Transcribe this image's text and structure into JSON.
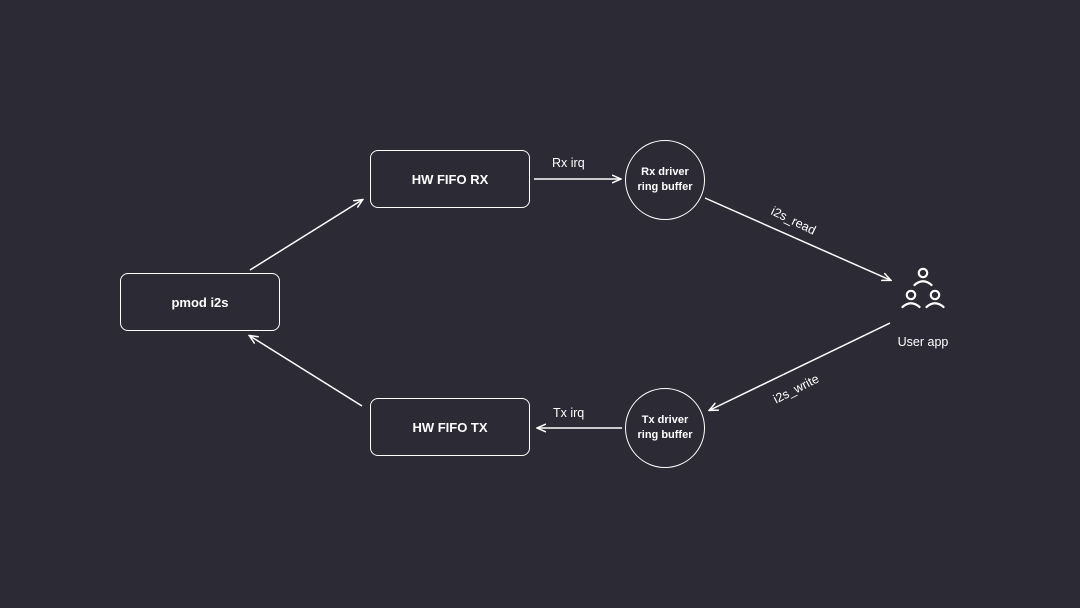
{
  "nodes": {
    "pmod": "pmod i2s",
    "fifo_rx": "HW FIFO RX",
    "fifo_tx": "HW FIFO TX",
    "rx_ring": "Rx driver\nring buffer",
    "tx_ring": "Tx driver\nring buffer",
    "user_app": "User app"
  },
  "edges": {
    "rx_irq": "Rx irq",
    "tx_irq": "Tx irq",
    "i2s_read": "i2s_read",
    "i2s_write": "i2s_write"
  }
}
